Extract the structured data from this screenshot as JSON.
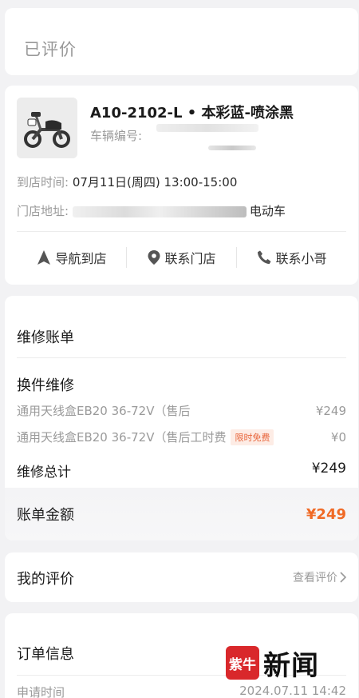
{
  "status": {
    "label": "已评价"
  },
  "vehicle": {
    "name": "A10-2102-L • 本彩蓝-喷涂黑",
    "number_label": "车辆编号:",
    "arrival_label": "到店时间:",
    "arrival_value": "07月11日(周四) 13:00-15:00",
    "address_label": "门店地址:",
    "address_value": "电动车"
  },
  "actions": [
    {
      "label": "导航到店",
      "icon": "navigation-icon"
    },
    {
      "label": "联系门店",
      "icon": "location-pin-icon"
    },
    {
      "label": "联系小哥",
      "icon": "phone-icon"
    }
  ],
  "bill": {
    "title": "维修账单",
    "section": "换件维修",
    "items": [
      {
        "name": "通用天线盒EB20 36-72V（售后",
        "badge": "",
        "price": "¥249"
      },
      {
        "name": "通用天线盒EB20 36-72V（售后工时费",
        "badge": "限时免费",
        "price": "¥0"
      }
    ],
    "total_label": "维修总计",
    "total_value": "¥249",
    "amount_label": "账单金额",
    "amount_value": "¥249"
  },
  "review": {
    "title": "我的评价",
    "link": "查看评价"
  },
  "order": {
    "title": "订单信息",
    "apply_label": "申请时间",
    "apply_value": "2024.07.11 14:42"
  },
  "watermark": {
    "logo": "紫牛",
    "text": "新闻"
  },
  "colors": {
    "accent": "#f06a25",
    "badge_bg": "#fdece5",
    "watermark_red": "#d9282b"
  }
}
